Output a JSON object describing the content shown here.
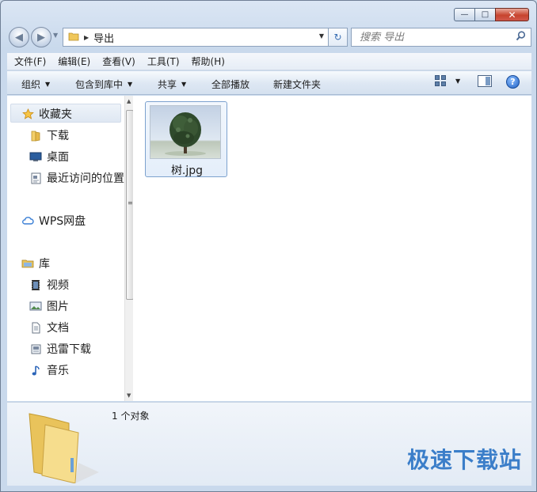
{
  "window": {
    "caption_buttons": {
      "minimize": "—",
      "maximize": "□",
      "close": "✕"
    }
  },
  "address_bar": {
    "crumbs": [
      "导出"
    ]
  },
  "search": {
    "placeholder": "搜索 导出"
  },
  "menubar": {
    "items": [
      "文件(F)",
      "编辑(E)",
      "查看(V)",
      "工具(T)",
      "帮助(H)"
    ]
  },
  "command_bar": {
    "organize": "组织",
    "include_in_library": "包含到库中",
    "share": "共享",
    "play_all": "全部播放",
    "new_folder": "新建文件夹",
    "help": "?"
  },
  "nav_pane": {
    "favorites": {
      "label": "收藏夹",
      "items": [
        "下载",
        "桌面",
        "最近访问的位置"
      ]
    },
    "cloud": {
      "label": "WPS网盘"
    },
    "libraries": {
      "label": "库",
      "items": [
        "视频",
        "图片",
        "文档",
        "迅雷下载",
        "音乐"
      ]
    }
  },
  "content": {
    "files": [
      {
        "name": "树.jpg",
        "type": "image"
      }
    ]
  },
  "details_pane": {
    "count_text": "1 个对象"
  },
  "watermark": "极速下载站",
  "colors": {
    "accent": "#3b7ec9",
    "close_button": "#c7442e",
    "frame": "#c9d9ec"
  }
}
